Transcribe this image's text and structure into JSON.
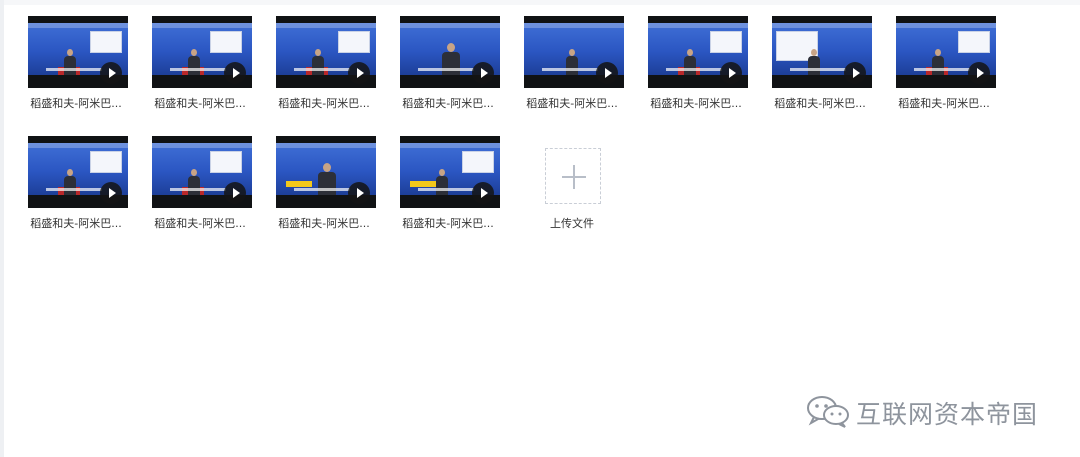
{
  "files": [
    {
      "name": "稻盛和夫-阿米巴...",
      "type": "video",
      "variant": "board"
    },
    {
      "name": "稻盛和夫-阿米巴...",
      "type": "video",
      "variant": "hall"
    },
    {
      "name": "稻盛和夫-阿米巴...",
      "type": "video",
      "variant": "board"
    },
    {
      "name": "稻盛和夫-阿米巴...",
      "type": "video",
      "variant": "closeup"
    },
    {
      "name": "稻盛和夫-阿米巴...",
      "type": "video",
      "variant": "banner"
    },
    {
      "name": "稻盛和夫-阿米巴...",
      "type": "video",
      "variant": "board"
    },
    {
      "name": "稻盛和夫-阿米巴...",
      "type": "video",
      "variant": "whiteboard"
    },
    {
      "name": "稻盛和夫-阿米巴...",
      "type": "video",
      "variant": "board"
    },
    {
      "name": "稻盛和夫-阿米巴...",
      "type": "video",
      "variant": "board"
    },
    {
      "name": "稻盛和夫-阿米巴...",
      "type": "video",
      "variant": "hall"
    },
    {
      "name": "稻盛和夫-阿米巴...",
      "type": "video",
      "variant": "yellow"
    },
    {
      "name": "稻盛和夫-阿米巴...",
      "type": "video",
      "variant": "yellow-board"
    }
  ],
  "upload": {
    "label": "上传文件",
    "icon": "plus-icon"
  },
  "watermark": {
    "text": "互联网资本帝国",
    "icon": "wechat-icon"
  },
  "colors": {
    "stage_blue": "#2b56c2",
    "lectern_red": "#b9282b",
    "label_text": "#333333",
    "watermark_gray": "#8e949d",
    "upload_border": "#c9ced6"
  }
}
